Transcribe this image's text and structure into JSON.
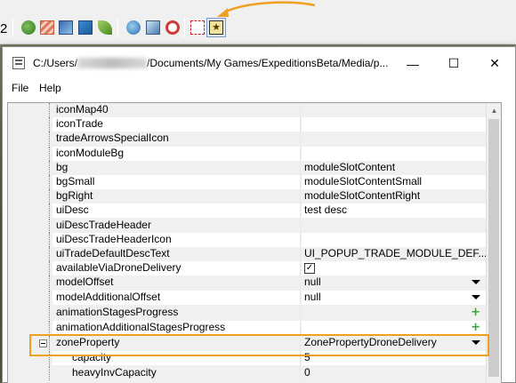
{
  "toolbar": {
    "number": "2",
    "icons": [
      "green-sphere-icon",
      "striped-square-icon",
      "cube-icon",
      "blue-box-icon",
      "leaf-icon",
      "globe-icon",
      "cube-gear-icon",
      "red-ring-icon",
      "dashed-square-icon",
      "star-icon"
    ]
  },
  "window": {
    "title_prefix": "C:/Users/",
    "title_suffix": "/Documents/My Games/ExpeditionsBeta/Media/p...",
    "minimize": "—",
    "maximize": "☐",
    "close": "✕"
  },
  "menu": {
    "file": "File",
    "help": "Help"
  },
  "grid": {
    "rows": [
      {
        "name": "iconMap40",
        "value": "",
        "grey": true
      },
      {
        "name": "iconTrade",
        "value": "",
        "grey": false
      },
      {
        "name": "tradeArrowsSpecialIcon",
        "value": "",
        "grey": true
      },
      {
        "name": "iconModuleBg",
        "value": "",
        "grey": false
      },
      {
        "name": "bg",
        "value": "moduleSlotContent",
        "grey": true
      },
      {
        "name": "bgSmall",
        "value": "moduleSlotContentSmall",
        "grey": false
      },
      {
        "name": "bgRight",
        "value": "moduleSlotContentRight",
        "grey": true
      },
      {
        "name": "uiDesc",
        "value": "test desc",
        "grey": false
      },
      {
        "name": "uiDescTradeHeader",
        "value": "",
        "grey": true
      },
      {
        "name": "uiDescTradeHeaderIcon",
        "value": "",
        "grey": false
      },
      {
        "name": "uiTradeDefaultDescText",
        "value": "UI_POPUP_TRADE_MODULE_DEF...",
        "grey": true
      },
      {
        "name": "availableViaDroneDelivery",
        "value": "✓",
        "grey": false
      },
      {
        "name": "modelOffset",
        "value": "null",
        "grey": true
      },
      {
        "name": "modelAdditionalOffset",
        "value": "null",
        "grey": false
      },
      {
        "name": "animationStagesProgress",
        "value": "",
        "grey": true
      },
      {
        "name": "animationAdditionalStagesProgress",
        "value": "",
        "grey": false
      },
      {
        "name": "zoneProperty",
        "value": "ZonePropertyDroneDelivery",
        "grey": true
      },
      {
        "name": "capacity",
        "value": "5",
        "grey": false
      },
      {
        "name": "heavyInvCapacity",
        "value": "0",
        "grey": true
      }
    ]
  },
  "colors": {
    "highlight": "#f0a020",
    "plus": "#3aa03a"
  }
}
